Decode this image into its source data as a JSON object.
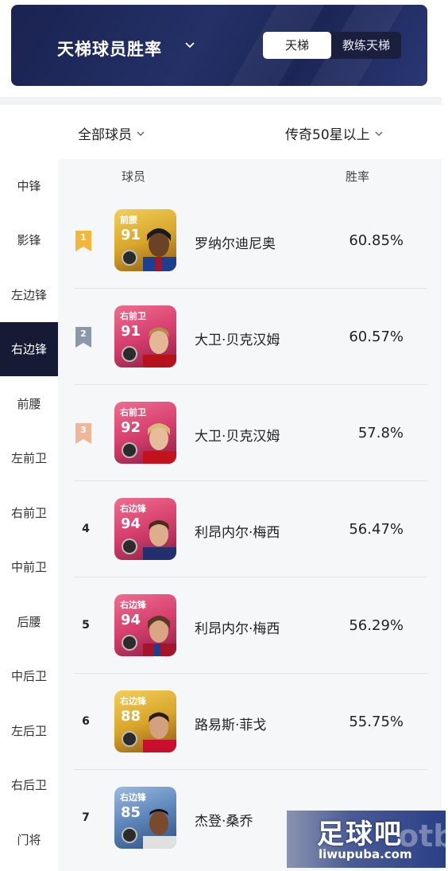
{
  "header": {
    "title": "天梯球员胜率",
    "tabs": [
      "天梯",
      "教练天梯"
    ],
    "active_tab": 0
  },
  "filters": {
    "players": "全部球员",
    "level": "传奇50星以上"
  },
  "sidebar": {
    "items": [
      "中锋",
      "影锋",
      "左边锋",
      "右边锋",
      "前腰",
      "左前卫",
      "右前卫",
      "中前卫",
      "后腰",
      "中后卫",
      "左后卫",
      "右后卫",
      "门将"
    ],
    "active": 3
  },
  "table": {
    "headers": {
      "player": "球员",
      "rate": "胜率"
    },
    "rows": [
      {
        "rank": "1",
        "position": "前腰",
        "rating": "91",
        "name": "罗纳尔迪尼奥",
        "win_rate": "60.85%"
      },
      {
        "rank": "2",
        "position": "右前卫",
        "rating": "91",
        "name": "大卫·贝克汉姆",
        "win_rate": "60.57%"
      },
      {
        "rank": "3",
        "position": "右前卫",
        "rating": "92",
        "name": "大卫·贝克汉姆",
        "win_rate": "57.8%"
      },
      {
        "rank": "4",
        "position": "右边锋",
        "rating": "94",
        "name": "利昂内尔·梅西",
        "win_rate": "56.47%"
      },
      {
        "rank": "5",
        "position": "右边锋",
        "rating": "94",
        "name": "利昂内尔·梅西",
        "win_rate": "56.29%"
      },
      {
        "rank": "6",
        "position": "右边锋",
        "rating": "88",
        "name": "路易斯·菲戈",
        "win_rate": "55.75%"
      },
      {
        "rank": "7",
        "position": "右边锋",
        "rating": "85",
        "name": "杰登·桑乔",
        "win_rate": ""
      }
    ]
  },
  "watermark": {
    "title": "足球吧",
    "url": "liwupuba.com",
    "bg_text": "otba"
  },
  "colors": {
    "header_bg": "#1f2a5c",
    "sidebar_active": "#161a35",
    "rank1": "#f3b53a",
    "rank2": "#8d97ac",
    "rank3": "#efb79a",
    "card_gold": "#d9a62a",
    "card_pink": "#d63f6e",
    "card_blue": "#5a84b9"
  }
}
